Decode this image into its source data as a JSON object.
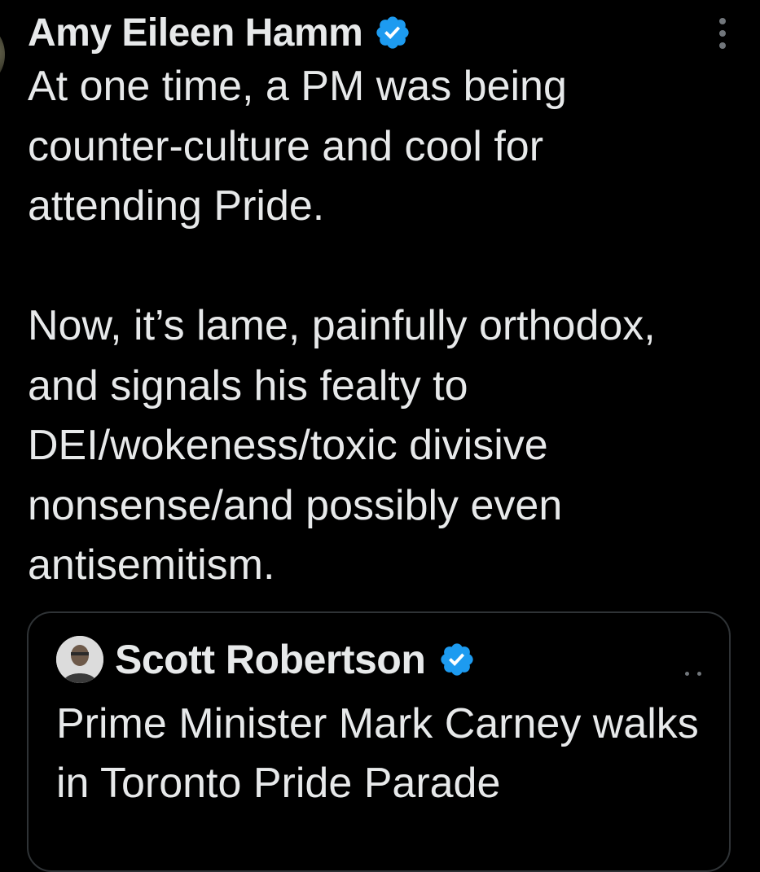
{
  "tweet": {
    "author_name": "Amy Eileen Hamm",
    "verified_icon": "verified-badge-icon",
    "more_icon": "more-options-icon",
    "paragraph_1": "At one time, a PM was being counter-culture and cool for attending Pride.",
    "paragraph_2": "Now, it’s lame, painfully orthodox, and signals his fealty to DEI/wokeness/toxic divisive nonsense/and possibly even antisemitism."
  },
  "quote": {
    "author_name": "Scott Robertson",
    "verified_icon": "verified-badge-icon",
    "text": "Prime Minister Mark Carney walks in Toronto Pride Parade"
  },
  "colors": {
    "background": "#000000",
    "text": "#e7e9ea",
    "verified_blue": "#1d9bf0",
    "border": "#2f3336",
    "muted": "#71767b"
  }
}
